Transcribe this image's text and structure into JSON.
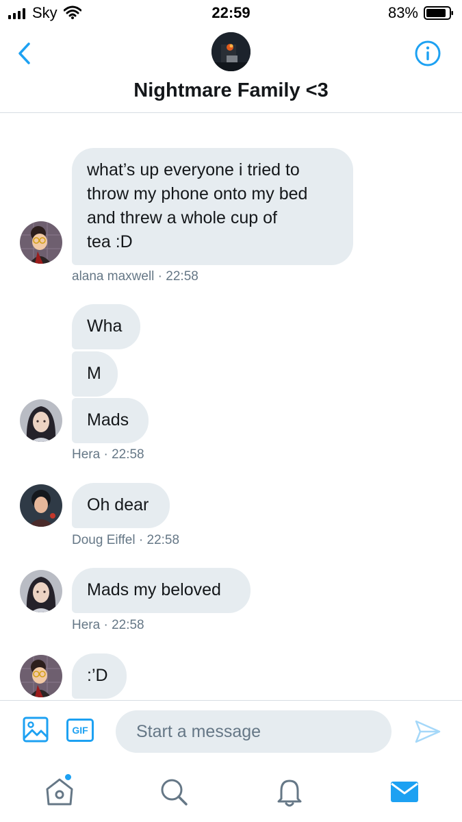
{
  "status_bar": {
    "carrier": "Sky",
    "time": "22:59",
    "battery": "83%"
  },
  "header": {
    "title": "Nightmare Family <3",
    "back_icon": "chevron-left-icon",
    "info_icon": "info-icon"
  },
  "messages": [
    {
      "lines": [
        "what’s up everyone i tried to",
        "throw my phone onto my bed",
        "and threw a whole cup of",
        "tea :D"
      ],
      "author": "alana maxwell",
      "time": "22:58"
    },
    {
      "text": "Wha"
    },
    {
      "text": "M"
    },
    {
      "text": "Mads",
      "author": "Hera",
      "time": "22:58"
    },
    {
      "text": "Oh dear",
      "author": "Doug Eiffel",
      "time": "22:58"
    },
    {
      "text": "Mads my beloved",
      "author": "Hera",
      "time": "22:58"
    },
    {
      "text": ":’D"
    }
  ],
  "meta_separator": " · ",
  "composer": {
    "placeholder": "Start a message",
    "gif_label": "GIF"
  },
  "tabs": [
    "home-icon",
    "search-icon",
    "notifications-icon",
    "messages-icon"
  ],
  "colors": {
    "accent": "#1da1f2",
    "bubble": "#e6ecf0",
    "meta_text": "#657786"
  }
}
